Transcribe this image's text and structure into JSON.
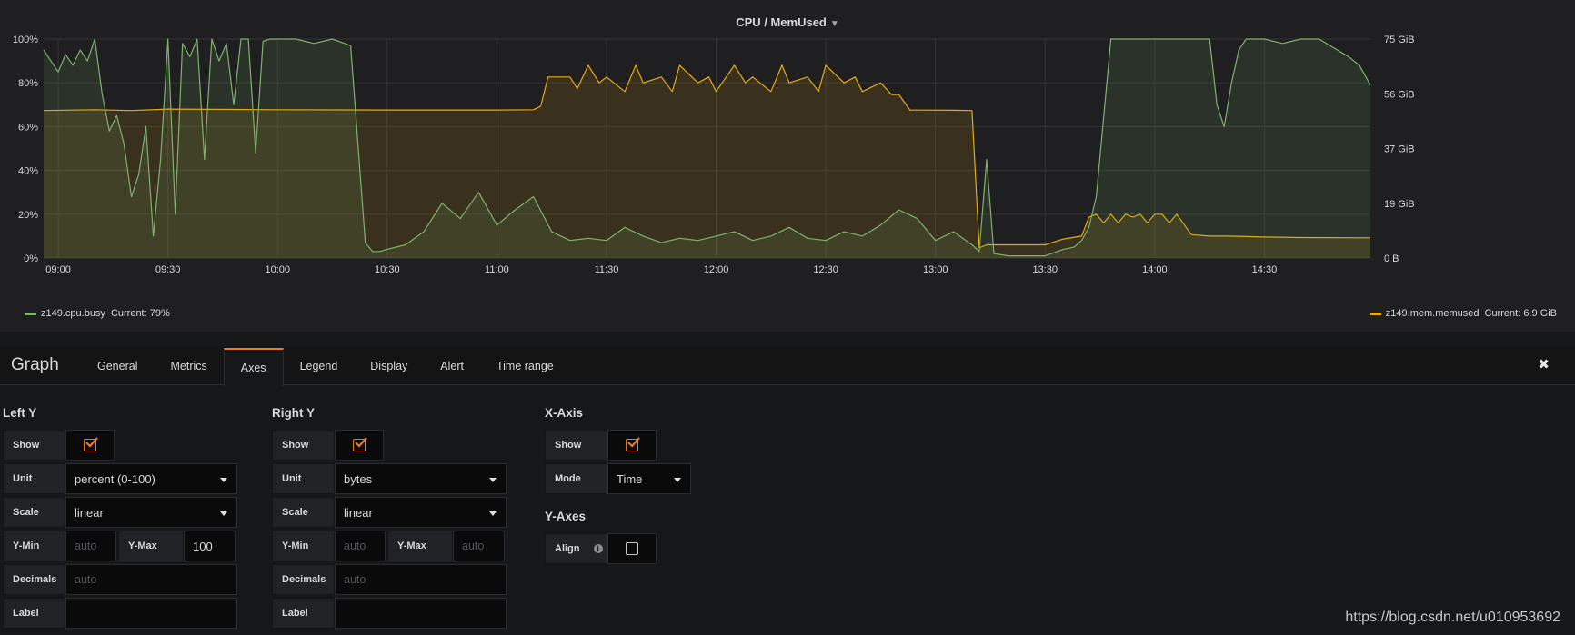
{
  "panel": {
    "title": "CPU / MemUsed"
  },
  "chart_data": {
    "type": "line",
    "title": "CPU / MemUsed",
    "x_ticks": [
      "09:00",
      "09:30",
      "10:00",
      "10:30",
      "11:00",
      "11:30",
      "12:00",
      "12:30",
      "13:00",
      "13:30",
      "14:00",
      "14:30"
    ],
    "x_range": [
      "08:56",
      "14:59"
    ],
    "left_axis": {
      "unit": "percent",
      "ticks": [
        "0%",
        "20%",
        "40%",
        "60%",
        "80%",
        "100%"
      ],
      "ylim": [
        0,
        100
      ]
    },
    "right_axis": {
      "unit": "GiB",
      "ticks": [
        "0 B",
        "19 GiB",
        "37 GiB",
        "56 GiB",
        "75 GiB"
      ],
      "ylim": [
        0,
        75
      ]
    },
    "grid": true,
    "series": [
      {
        "name": "z149.cpu.busy",
        "axis": "left",
        "color": "#7eb26d",
        "x": [
          "08:56",
          "08:58",
          "09:00",
          "09:02",
          "09:04",
          "09:06",
          "09:08",
          "09:10",
          "09:12",
          "09:14",
          "09:16",
          "09:18",
          "09:20",
          "09:22",
          "09:24",
          "09:26",
          "09:28",
          "09:30",
          "09:32",
          "09:34",
          "09:36",
          "09:38",
          "09:40",
          "09:42",
          "09:44",
          "09:46",
          "09:48",
          "09:50",
          "09:52",
          "09:54",
          "09:56",
          "09:58",
          "10:00",
          "10:05",
          "10:10",
          "10:15",
          "10:20",
          "10:24",
          "10:26",
          "10:28",
          "10:30",
          "10:35",
          "10:40",
          "10:45",
          "10:50",
          "10:55",
          "11:00",
          "11:05",
          "11:10",
          "11:15",
          "11:20",
          "11:25",
          "11:30",
          "11:35",
          "11:40",
          "11:45",
          "11:50",
          "11:55",
          "12:00",
          "12:05",
          "12:10",
          "12:15",
          "12:20",
          "12:25",
          "12:30",
          "12:35",
          "12:40",
          "12:45",
          "12:50",
          "12:55",
          "13:00",
          "13:05",
          "13:10",
          "13:12",
          "13:14",
          "13:16",
          "13:20",
          "13:25",
          "13:30",
          "13:35",
          "13:38",
          "13:40",
          "13:42",
          "13:44",
          "13:48",
          "13:50",
          "13:55",
          "14:00",
          "14:05",
          "14:10",
          "14:15",
          "14:17",
          "14:19",
          "14:21",
          "14:23",
          "14:25",
          "14:30",
          "14:35",
          "14:40",
          "14:45",
          "14:50",
          "14:53",
          "14:56",
          "14:59"
        ],
        "y": [
          95,
          90,
          85,
          93,
          88,
          95,
          90,
          100,
          75,
          58,
          65,
          52,
          28,
          38,
          60,
          10,
          45,
          100,
          20,
          98,
          92,
          100,
          45,
          100,
          90,
          98,
          70,
          100,
          100,
          48,
          99,
          100,
          100,
          100,
          98,
          100,
          97,
          7,
          3,
          3,
          4,
          6,
          12,
          25,
          18,
          30,
          15,
          22,
          28,
          12,
          8,
          9,
          8,
          14,
          10,
          7,
          9,
          8,
          10,
          12,
          8,
          10,
          14,
          9,
          8,
          12,
          10,
          15,
          22,
          18,
          8,
          12,
          6,
          3,
          45,
          2,
          1,
          1,
          1,
          4,
          5,
          8,
          14,
          28,
          100,
          100,
          100,
          100,
          100,
          100,
          100,
          70,
          60,
          80,
          95,
          100,
          100,
          98,
          100,
          100,
          95,
          92,
          88,
          79
        ],
        "current": "79%"
      },
      {
        "name": "z149.mem.memused",
        "axis": "right",
        "color": "#e5ac0e",
        "x": [
          "08:56",
          "09:10",
          "09:20",
          "09:30",
          "10:00",
          "10:30",
          "11:00",
          "11:10",
          "11:12",
          "11:14",
          "11:20",
          "11:22",
          "11:25",
          "11:28",
          "11:30",
          "11:35",
          "11:38",
          "11:40",
          "11:45",
          "11:48",
          "11:50",
          "11:55",
          "11:58",
          "12:00",
          "12:05",
          "12:08",
          "12:10",
          "12:15",
          "12:18",
          "12:20",
          "12:25",
          "12:28",
          "12:30",
          "12:35",
          "12:38",
          "12:40",
          "12:45",
          "12:48",
          "12:50",
          "12:53",
          "13:05",
          "13:10",
          "13:12",
          "13:14",
          "13:20",
          "13:30",
          "13:35",
          "13:40",
          "13:42",
          "13:44",
          "13:46",
          "13:48",
          "13:50",
          "13:52",
          "13:54",
          "13:56",
          "13:58",
          "14:00",
          "14:02",
          "14:04",
          "14:06",
          "14:10",
          "14:15",
          "14:20",
          "14:30",
          "14:40",
          "14:59"
        ],
        "y": [
          50.5,
          50.8,
          50.5,
          51,
          50.8,
          50.7,
          50.7,
          50.8,
          52,
          62,
          62,
          58,
          66,
          60,
          62,
          57,
          66,
          60,
          62,
          57,
          66,
          60,
          62,
          57,
          66,
          60,
          62,
          57,
          66,
          60,
          62,
          57,
          66,
          60,
          62,
          57,
          60,
          56,
          56,
          50.7,
          50.6,
          50.5,
          3.5,
          4.5,
          4.5,
          4.5,
          6.5,
          7.5,
          14,
          15,
          12,
          15,
          12,
          15,
          14,
          15,
          12,
          15,
          15,
          12,
          15,
          8,
          7.5,
          7.5,
          7.2,
          7.0,
          6.9
        ],
        "current": "6.9 GiB"
      }
    ]
  },
  "legend": {
    "left": {
      "name": "z149.cpu.busy",
      "current_label": "Current:",
      "current": "79%",
      "color": "#7eb26d"
    },
    "right": {
      "name": "z149.mem.memused",
      "current_label": "Current:",
      "current": "6.9 GiB",
      "color": "#e5ac0e"
    }
  },
  "editor": {
    "title": "Graph",
    "tabs": [
      "General",
      "Metrics",
      "Axes",
      "Legend",
      "Display",
      "Alert",
      "Time range"
    ],
    "active_tab": "Axes",
    "close_glyph": "✖"
  },
  "left_y": {
    "title": "Left Y",
    "show_label": "Show",
    "show": true,
    "unit_label": "Unit",
    "unit": "percent (0-100)",
    "scale_label": "Scale",
    "scale": "linear",
    "ymin_label": "Y-Min",
    "ymin_placeholder": "auto",
    "ymax_label": "Y-Max",
    "ymax": "100",
    "decimals_label": "Decimals",
    "decimals_placeholder": "auto",
    "label_label": "Label"
  },
  "right_y": {
    "title": "Right Y",
    "show_label": "Show",
    "show": true,
    "unit_label": "Unit",
    "unit": "bytes",
    "scale_label": "Scale",
    "scale": "linear",
    "ymin_label": "Y-Min",
    "ymin_placeholder": "auto",
    "ymax_label": "Y-Max",
    "ymax_placeholder": "auto",
    "decimals_label": "Decimals",
    "decimals_placeholder": "auto",
    "label_label": "Label"
  },
  "x_axis": {
    "title": "X-Axis",
    "show_label": "Show",
    "show": true,
    "mode_label": "Mode",
    "mode": "Time"
  },
  "y_axes": {
    "title": "Y-Axes",
    "align_label": "Align",
    "align": false
  },
  "watermark": "https://blog.csdn.net/u010953692"
}
